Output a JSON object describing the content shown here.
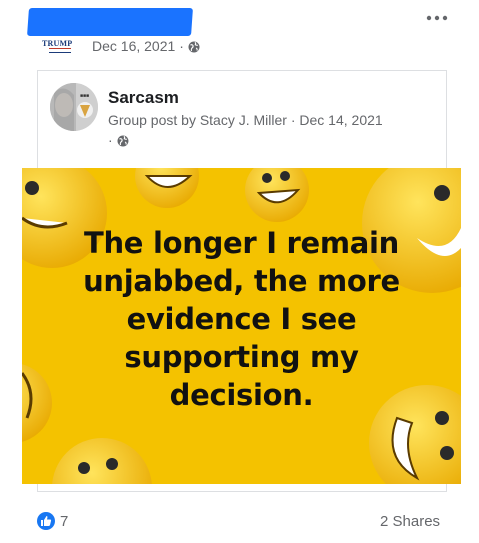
{
  "post": {
    "logo_text": "TRUMP",
    "date": "Dec 16, 2021",
    "separator": "·",
    "audience_icon": "globe-icon",
    "more_icon": "more-options-icon"
  },
  "shared_post": {
    "group_name": "Sarcasm",
    "meta": "Group post by Stacy J. Miller · Dec 14, 2021",
    "separator": "·",
    "audience_icon": "globe-icon"
  },
  "meme": {
    "lines": [
      "The longer I remain",
      "unjabbed, the more",
      "evidence I see",
      "supporting my",
      "decision."
    ],
    "background_color": "#f4c200"
  },
  "footer": {
    "reaction_icon": "like-icon",
    "like_count": "7",
    "shares": "2 Shares"
  }
}
